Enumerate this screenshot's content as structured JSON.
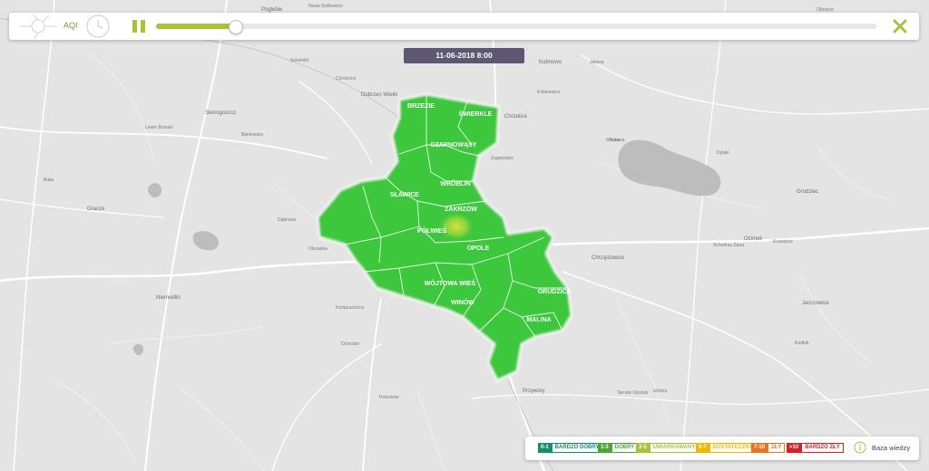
{
  "toolbar": {
    "indicator_label": "AQI",
    "playback_progress": 0.11,
    "icons": {
      "logo": "network-logo-icon",
      "clock": "clock-icon",
      "pause": "pause-icon",
      "close": "close-x-icon"
    },
    "accent_color": "#a9c23a"
  },
  "date_display": "11-06-2018   8:00",
  "map": {
    "districts": [
      "BRZEZIE",
      "ŚWIERKLE",
      "CZARNOWĄSY",
      "WRÓBLIN",
      "SŁAWICE",
      "ZAKRZÓW",
      "PÓŁWIEŚ",
      "OPOLE",
      "WÓJTOWA WIEŚ",
      "WINÓW",
      "GRUDZICE",
      "MALINA"
    ],
    "towns": [
      "Poglebie",
      "Nowe Siolkowice",
      "Obrzyce",
      "Dobrzen Wielki",
      "Chróścice",
      "Kolanowice",
      "Kubnowo",
      "Jełowa",
      "Sokolniki",
      "Skorogoszcz",
      "Bierkowice",
      "Lewin Brzeski",
      "Chrzelice",
      "Murów",
      "Zagwiździe",
      "Ozimek",
      "Krasiejów",
      "Schodnia Stara",
      "Chrząstowice",
      "Dąbrowa",
      "Komprachcice",
      "Niemodlin",
      "Ochodze",
      "Prószków",
      "Przywory",
      "Tarnów Opolski",
      "Izbicko",
      "Jarczowice",
      "Kadłub",
      "Olszanka",
      "Grodziec",
      "Turawa",
      "Dylaki",
      "Gracze",
      "Biała"
    ],
    "land_color": "#e4e4e4",
    "district_color": "#3cc73c"
  },
  "legend": {
    "items": [
      {
        "range": "0-1",
        "label": "BARDZO DOBRY",
        "color": "#168e6b"
      },
      {
        "range": "1-3",
        "label": "DOBRY",
        "color": "#4aa63a"
      },
      {
        "range": "3-5",
        "label": "UMIARKOWANY",
        "color": "#a9c23a"
      },
      {
        "range": "5-7",
        "label": "DOSTATECZNY",
        "color": "#f2b800"
      },
      {
        "range": "7-10",
        "label": "ZŁY",
        "color": "#e8731f"
      },
      {
        "range": ">10",
        "label": "BARDZO ZŁY",
        "color": "#d32222"
      }
    ],
    "knowledge_base": "Baza wiedzy",
    "info_icon": "info-circle-icon"
  }
}
